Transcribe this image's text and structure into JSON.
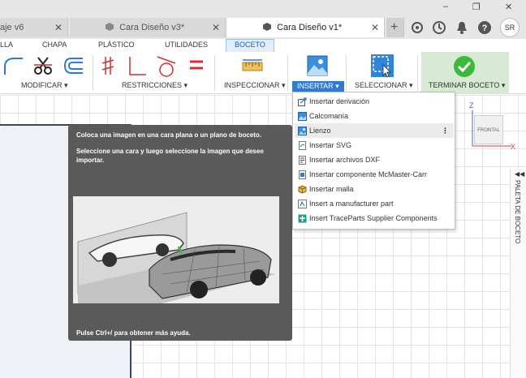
{
  "window": {
    "minimize": "–",
    "restore": "❐",
    "close": "✕"
  },
  "tabs": [
    {
      "label": "aje v6",
      "close": "✕"
    },
    {
      "label": "Cara Diseño v3*",
      "close": "✕"
    },
    {
      "label": "Cara Diseño v1*",
      "close": "✕"
    }
  ],
  "new_tab": "+",
  "avatar": "SR",
  "ribbon_tabs": [
    "LLA",
    "CHAPA",
    "PLÁSTICO",
    "UTILIDADES",
    "BOCETO"
  ],
  "toolbar_groups": {
    "modificar": "MODIFICAR ▾",
    "restricciones": "RESTRICCIONES ▾",
    "inspeccionar": "INSPECCIONAR ▾",
    "insertar": "INSERTAR ▾",
    "seleccionar": "SELECCIONAR ▾",
    "terminar": "TERMINAR BOCETO ▾"
  },
  "dropdown": {
    "items": [
      {
        "label": "Insertar derivación"
      },
      {
        "label": "Calcomanía"
      },
      {
        "label": "Lienzo",
        "more": "⋮"
      },
      {
        "label": "Insertar SVG"
      },
      {
        "label": "Insertar archivos DXF"
      },
      {
        "label": "Insertar componente McMaster-Carr"
      },
      {
        "label": "Insertar malla"
      },
      {
        "label": "Insert a manufacturer part"
      },
      {
        "label": "Insert TraceParts Supplier Components"
      }
    ]
  },
  "tooltip": {
    "line1": "Coloca una imagen en una cara plana o un plano de boceto.",
    "line2": "Seleccione una cara y luego seleccione la imagen que desee importar.",
    "help": "Pulse Ctrl+/ para obtener más ayuda."
  },
  "viewcube": {
    "face": "FRONTAL",
    "z": "Z",
    "x": "X"
  },
  "palette": {
    "label": "PALETA DE BOCETO",
    "arrow": "◀◀"
  },
  "colors": {
    "accent": "#2f7bd3",
    "finish": "#3cb83c",
    "tooltip_bg": "#5a5a5a"
  }
}
